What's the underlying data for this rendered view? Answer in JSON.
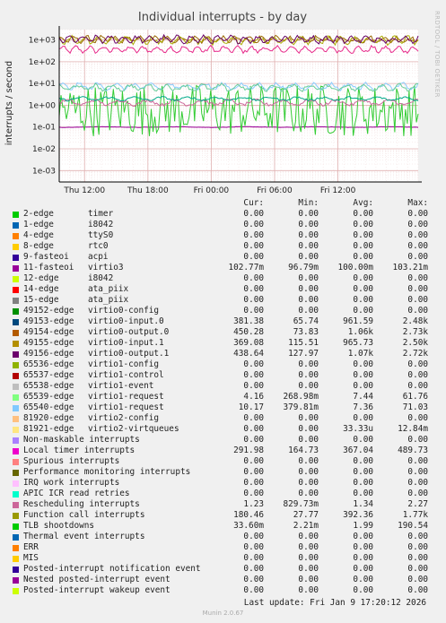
{
  "chart_data": {
    "type": "line",
    "title": "Individual interrupts - by day",
    "ylabel": "interrupts / second",
    "yscale": "log",
    "ylim": [
      0.0003,
      3000
    ],
    "yticks": [
      "1e+03",
      "1e+02",
      "1e+01",
      "1e+00",
      "1e-01",
      "1e-02",
      "1e-03"
    ],
    "xticks": [
      "Thu 12:00",
      "Thu 18:00",
      "Fri 00:00",
      "Fri 06:00",
      "Fri 12:00"
    ],
    "grid": true,
    "series": [
      {
        "name": "Local timer interrupts",
        "color": "#e7298a",
        "level": 367.04,
        "amp": 1.6,
        "period": 1.5
      },
      {
        "name": "49154-edge",
        "color": "#996600",
        "level": 1060,
        "amp": 1.55,
        "period": 1.5
      },
      {
        "name": "49155-edge",
        "color": "#aaaa00",
        "level": 965.73,
        "amp": 1.7,
        "period": 1.5
      },
      {
        "name": "49156-edge",
        "color": "#660066",
        "level": 1070,
        "amp": 1.65,
        "period": 1.5
      },
      {
        "name": "11-fasteoi virtio3",
        "color": "#990099",
        "level": 0.1,
        "amp": 1.05,
        "period": 8
      },
      {
        "name": "Function call interrupts",
        "color": "#33cc33",
        "level": 0.6,
        "amp": 6,
        "period": 1
      },
      {
        "name": "Rescheduling interrupts",
        "color": "#cc6699",
        "level": 1.34,
        "amp": 1.5,
        "period": 3
      },
      {
        "name": "65540-edge",
        "color": "#88ccff",
        "level": 7.36,
        "amp": 1.6,
        "period": 2
      },
      {
        "name": "65539-edge",
        "color": "#66cc99",
        "level": 6.5,
        "amp": 1.6,
        "period": 2
      },
      {
        "name": "TLB shootdowns",
        "color": "#00aa88",
        "level": 2.0,
        "amp": 1.3,
        "period": 3
      }
    ]
  },
  "legend": {
    "headers": [
      "Cur:",
      "Min:",
      "Avg:",
      "Max:"
    ],
    "rows": [
      {
        "name": "2-edge",
        "type": "timer",
        "color": "#00cc00",
        "cur": "0.00",
        "min": "0.00",
        "avg": "0.00",
        "max": "0.00"
      },
      {
        "name": "1-edge",
        "type": "i8042",
        "color": "#0066b3",
        "cur": "0.00",
        "min": "0.00",
        "avg": "0.00",
        "max": "0.00"
      },
      {
        "name": "4-edge",
        "type": "ttyS0",
        "color": "#ff8000",
        "cur": "0.00",
        "min": "0.00",
        "avg": "0.00",
        "max": "0.00"
      },
      {
        "name": "8-edge",
        "type": "rtc0",
        "color": "#ffcc00",
        "cur": "0.00",
        "min": "0.00",
        "avg": "0.00",
        "max": "0.00"
      },
      {
        "name": "9-fasteoi",
        "type": "acpi",
        "color": "#330099",
        "cur": "0.00",
        "min": "0.00",
        "avg": "0.00",
        "max": "0.00"
      },
      {
        "name": "11-fasteoi",
        "type": "virtio3",
        "color": "#990099",
        "cur": "102.77m",
        "min": "96.79m",
        "avg": "100.00m",
        "max": "103.21m"
      },
      {
        "name": "12-edge",
        "type": "i8042",
        "color": "#ccff00",
        "cur": "0.00",
        "min": "0.00",
        "avg": "0.00",
        "max": "0.00"
      },
      {
        "name": "14-edge",
        "type": "ata_piix",
        "color": "#ff0000",
        "cur": "0.00",
        "min": "0.00",
        "avg": "0.00",
        "max": "0.00"
      },
      {
        "name": "15-edge",
        "type": "ata_piix",
        "color": "#808080",
        "cur": "0.00",
        "min": "0.00",
        "avg": "0.00",
        "max": "0.00"
      },
      {
        "name": "49152-edge",
        "type": "virtio0-config",
        "color": "#008f00",
        "cur": "0.00",
        "min": "0.00",
        "avg": "0.00",
        "max": "0.00"
      },
      {
        "name": "49153-edge",
        "type": "virtio0-input.0",
        "color": "#00487d",
        "cur": "381.38",
        "min": "65.74",
        "avg": "961.59",
        "max": "2.48k"
      },
      {
        "name": "49154-edge",
        "type": "virtio0-output.0",
        "color": "#b35a00",
        "cur": "450.28",
        "min": "73.83",
        "avg": "1.06k",
        "max": "2.73k"
      },
      {
        "name": "49155-edge",
        "type": "virtio0-input.1",
        "color": "#b38f00",
        "cur": "369.08",
        "min": "115.51",
        "avg": "965.73",
        "max": "2.50k"
      },
      {
        "name": "49156-edge",
        "type": "virtio0-output.1",
        "color": "#6b006b",
        "cur": "438.64",
        "min": "127.97",
        "avg": "1.07k",
        "max": "2.72k"
      },
      {
        "name": "65536-edge",
        "type": "virtio1-config",
        "color": "#8fb300",
        "cur": "0.00",
        "min": "0.00",
        "avg": "0.00",
        "max": "0.00"
      },
      {
        "name": "65537-edge",
        "type": "virtio1-control",
        "color": "#b30000",
        "cur": "0.00",
        "min": "0.00",
        "avg": "0.00",
        "max": "0.00"
      },
      {
        "name": "65538-edge",
        "type": "virtio1-event",
        "color": "#bebebe",
        "cur": "0.00",
        "min": "0.00",
        "avg": "0.00",
        "max": "0.00"
      },
      {
        "name": "65539-edge",
        "type": "virtio1-request",
        "color": "#80ff80",
        "cur": "4.16",
        "min": "268.98m",
        "avg": "7.44",
        "max": "61.76"
      },
      {
        "name": "65540-edge",
        "type": "virtio1-request",
        "color": "#80c9ff",
        "cur": "10.17",
        "min": "379.81m",
        "avg": "7.36",
        "max": "71.03"
      },
      {
        "name": "81920-edge",
        "type": "virtio2-config",
        "color": "#ffc080",
        "cur": "0.00",
        "min": "0.00",
        "avg": "0.00",
        "max": "0.00"
      },
      {
        "name": "81921-edge",
        "type": "virtio2-virtqueues",
        "color": "#ffe680",
        "cur": "0.00",
        "min": "0.00",
        "avg": "33.33u",
        "max": "12.84m"
      },
      {
        "name": "Non-maskable interrupts",
        "type": "",
        "color": "#aa80ff",
        "cur": "0.00",
        "min": "0.00",
        "avg": "0.00",
        "max": "0.00"
      },
      {
        "name": "Local timer interrupts",
        "type": "",
        "color": "#ee00cc",
        "cur": "291.98",
        "min": "164.73",
        "avg": "367.04",
        "max": "489.73"
      },
      {
        "name": "Spurious interrupts",
        "type": "",
        "color": "#ff8080",
        "cur": "0.00",
        "min": "0.00",
        "avg": "0.00",
        "max": "0.00"
      },
      {
        "name": "Performance monitoring interrupts",
        "type": "",
        "color": "#666600",
        "cur": "0.00",
        "min": "0.00",
        "avg": "0.00",
        "max": "0.00"
      },
      {
        "name": "IRQ work interrupts",
        "type": "",
        "color": "#ffbfff",
        "cur": "0.00",
        "min": "0.00",
        "avg": "0.00",
        "max": "0.00"
      },
      {
        "name": "APIC ICR read retries",
        "type": "",
        "color": "#00ffcc",
        "cur": "0.00",
        "min": "0.00",
        "avg": "0.00",
        "max": "0.00"
      },
      {
        "name": "Rescheduling interrupts",
        "type": "",
        "color": "#cc6699",
        "cur": "1.23",
        "min": "829.73m",
        "avg": "1.34",
        "max": "2.27"
      },
      {
        "name": "Function call interrupts",
        "type": "",
        "color": "#999900",
        "cur": "180.46",
        "min": "27.77",
        "avg": "392.36",
        "max": "1.77k"
      },
      {
        "name": "TLB shootdowns",
        "type": "",
        "color": "#00cc00",
        "cur": "33.60m",
        "min": "2.21m",
        "avg": "1.99",
        "max": "190.54"
      },
      {
        "name": "Thermal event interrupts",
        "type": "",
        "color": "#0066b3",
        "cur": "0.00",
        "min": "0.00",
        "avg": "0.00",
        "max": "0.00"
      },
      {
        "name": "ERR",
        "type": "",
        "color": "#ff8000",
        "cur": "0.00",
        "min": "0.00",
        "avg": "0.00",
        "max": "0.00"
      },
      {
        "name": "MIS",
        "type": "",
        "color": "#ffcc00",
        "cur": "0.00",
        "min": "0.00",
        "avg": "0.00",
        "max": "0.00"
      },
      {
        "name": "Posted-interrupt notification event",
        "type": "",
        "color": "#330099",
        "cur": "0.00",
        "min": "0.00",
        "avg": "0.00",
        "max": "0.00"
      },
      {
        "name": "Nested posted-interrupt event",
        "type": "",
        "color": "#990099",
        "cur": "0.00",
        "min": "0.00",
        "avg": "0.00",
        "max": "0.00"
      },
      {
        "name": "Posted-interrupt wakeup event",
        "type": "",
        "color": "#ccff00",
        "cur": "0.00",
        "min": "0.00",
        "avg": "0.00",
        "max": "0.00"
      }
    ]
  },
  "last_update": "Last update: Fri Jan  9 17:20:12 2026",
  "side_label": "RRDTOOL / TOBI OETIKER",
  "footer": "Munin 2.0.67"
}
